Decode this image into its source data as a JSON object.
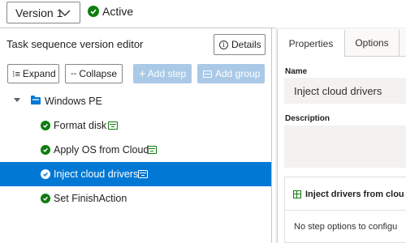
{
  "header": {
    "version_label": "Version 1",
    "status_label": "Active"
  },
  "left_pane": {
    "title": "Task sequence version editor",
    "details_label": "Details",
    "toolbar": {
      "expand_label": "Expand",
      "collapse_label": "Collapse",
      "add_step_label": "Add step",
      "add_group_label": "Add group"
    },
    "tree": {
      "group_label": "Windows PE",
      "steps": [
        {
          "label": "Format disk",
          "status": "success"
        },
        {
          "label": "Apply OS from Cloud",
          "status": "success"
        },
        {
          "label": "Inject cloud drivers",
          "status": "success",
          "selected": true
        },
        {
          "label": "Set FinishAction",
          "status": "success"
        }
      ]
    }
  },
  "right_pane": {
    "tabs": [
      "Properties",
      "Options",
      ""
    ],
    "active_tab": "Properties",
    "name_label": "Name",
    "name_value": "Inject cloud drivers",
    "description_label": "Description",
    "description_value": "",
    "options_heading": "Inject drivers from clou",
    "options_text": "No step options to configu"
  },
  "colors": {
    "accent": "#0078d4",
    "success": "#107c10",
    "disabled_button": "#a9c9e7"
  }
}
